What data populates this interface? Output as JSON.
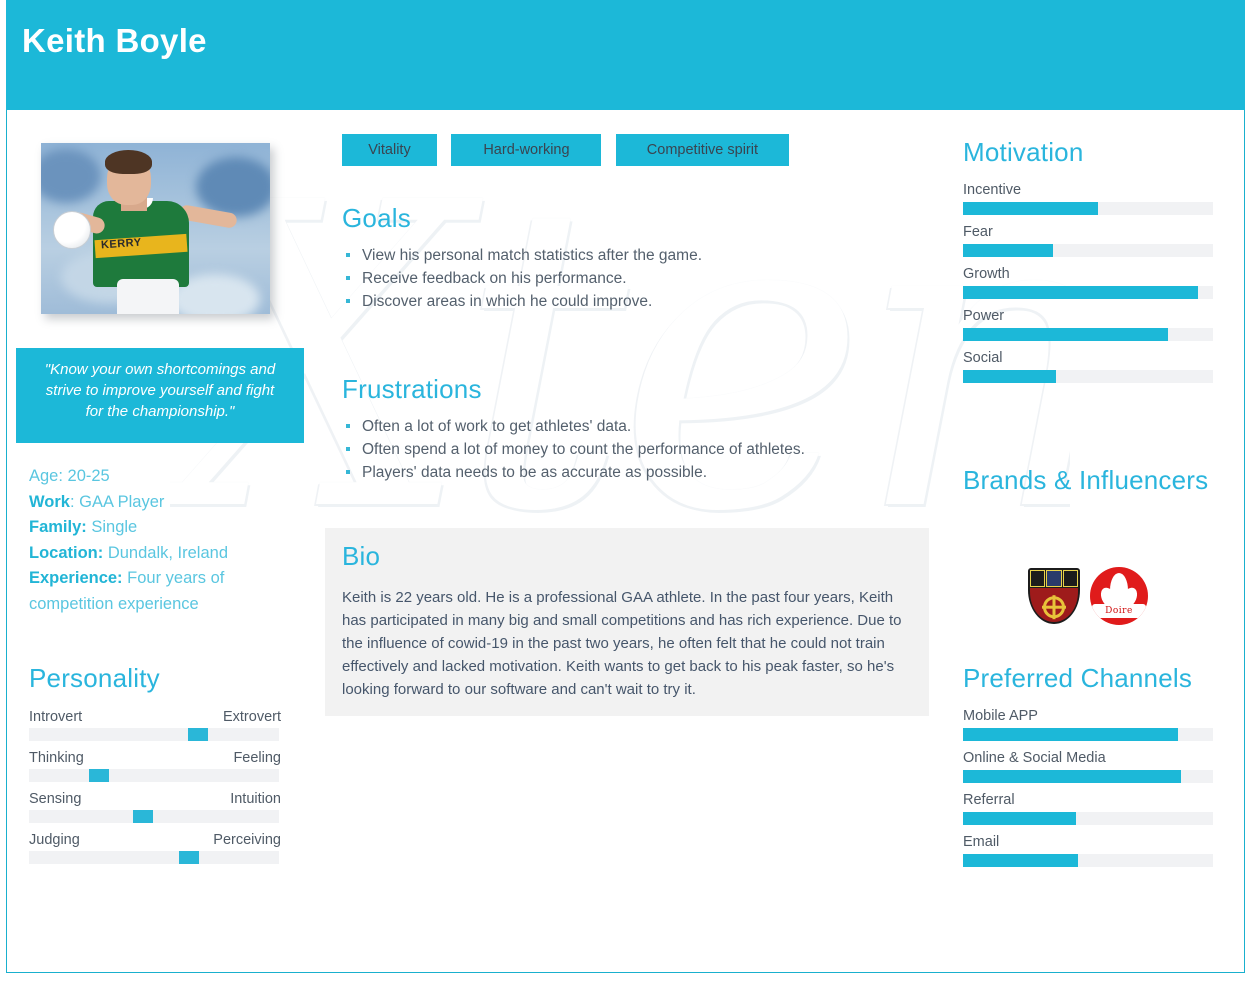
{
  "header": {
    "title": "Keith Boyle"
  },
  "photo": {
    "alt": "gaa-player-photo",
    "jersey_text": "KERRY"
  },
  "quote": {
    "text": "\"Know your own shortcomings and strive to improve yourself and fight for the championship.\""
  },
  "facts": [
    {
      "key": "Age:",
      "key_bold": false,
      "value": " 20-25"
    },
    {
      "key": "Work",
      "key_bold": true,
      "value": ": GAA Player"
    },
    {
      "key": "Family:",
      "key_bold": true,
      "value": " Single"
    },
    {
      "key": "Location:",
      "key_bold": true,
      "value": " Dundalk, Ireland"
    },
    {
      "key": "Experience:",
      "key_bold": true,
      "value": " Four years of competition experience"
    }
  ],
  "personality": {
    "title": "Personality",
    "sliders": [
      {
        "left": "Introvert",
        "right": "Extrovert",
        "value": 69
      },
      {
        "left": "Thinking",
        "right": "Feeling",
        "value": 26
      },
      {
        "left": "Sensing",
        "right": "Intuition",
        "value": 45
      },
      {
        "left": "Judging",
        "right": "Perceiving",
        "value": 65
      }
    ]
  },
  "tags": [
    "Vitality",
    "Hard-working",
    "Competitive spirit"
  ],
  "goals": {
    "title": "Goals",
    "items": [
      "View his personal match statistics after the game.",
      "Receive feedback on his performance.",
      "Discover areas in which he could improve."
    ]
  },
  "frustrations": {
    "title": "Frustrations",
    "items": [
      "Often a lot of work to get athletes' data.",
      "Often spend a lot of money to count the performance of athletes.",
      "Players' data needs to be as accurate as possible."
    ]
  },
  "bio": {
    "title": "Bio",
    "text": "Keith is 22 years old. He is a professional GAA athlete. In the past four years, Keith has participated in many big and small competitions and has rich experience. Due to the influence of cowid-19 in the past two years, he often felt that he could not train effectively and lacked motivation. Keith wants to get back to his peak faster, so he's looking forward to our software and can't wait to try it."
  },
  "motivation": {
    "title": "Motivation",
    "bars": [
      {
        "label": "Incentive",
        "value": 54
      },
      {
        "label": "Fear",
        "value": 36
      },
      {
        "label": "Growth",
        "value": 94
      },
      {
        "label": "Power",
        "value": 82
      },
      {
        "label": "Social",
        "value": 37
      }
    ]
  },
  "brands": {
    "title": "Brands & Influencers",
    "crests": [
      {
        "name": "louth-gaa-crest",
        "label": ""
      },
      {
        "name": "derry-gaa-crest",
        "label": "Doire"
      }
    ]
  },
  "channels": {
    "title": "Preferred Channels",
    "bars": [
      {
        "label": "Mobile APP",
        "value": 86
      },
      {
        "label": "Online & Social Media",
        "value": 87
      },
      {
        "label": "Referral",
        "value": 45
      },
      {
        "label": "Email",
        "value": 46
      }
    ]
  },
  "watermark": {
    "text": "Xtensio"
  },
  "colors": {
    "accent": "#1CB8D8",
    "accent_heading": "#2AB5DD",
    "track": "#F1F2F4",
    "body_text": "#54606D",
    "bio_bg": "#F2F2F2"
  }
}
